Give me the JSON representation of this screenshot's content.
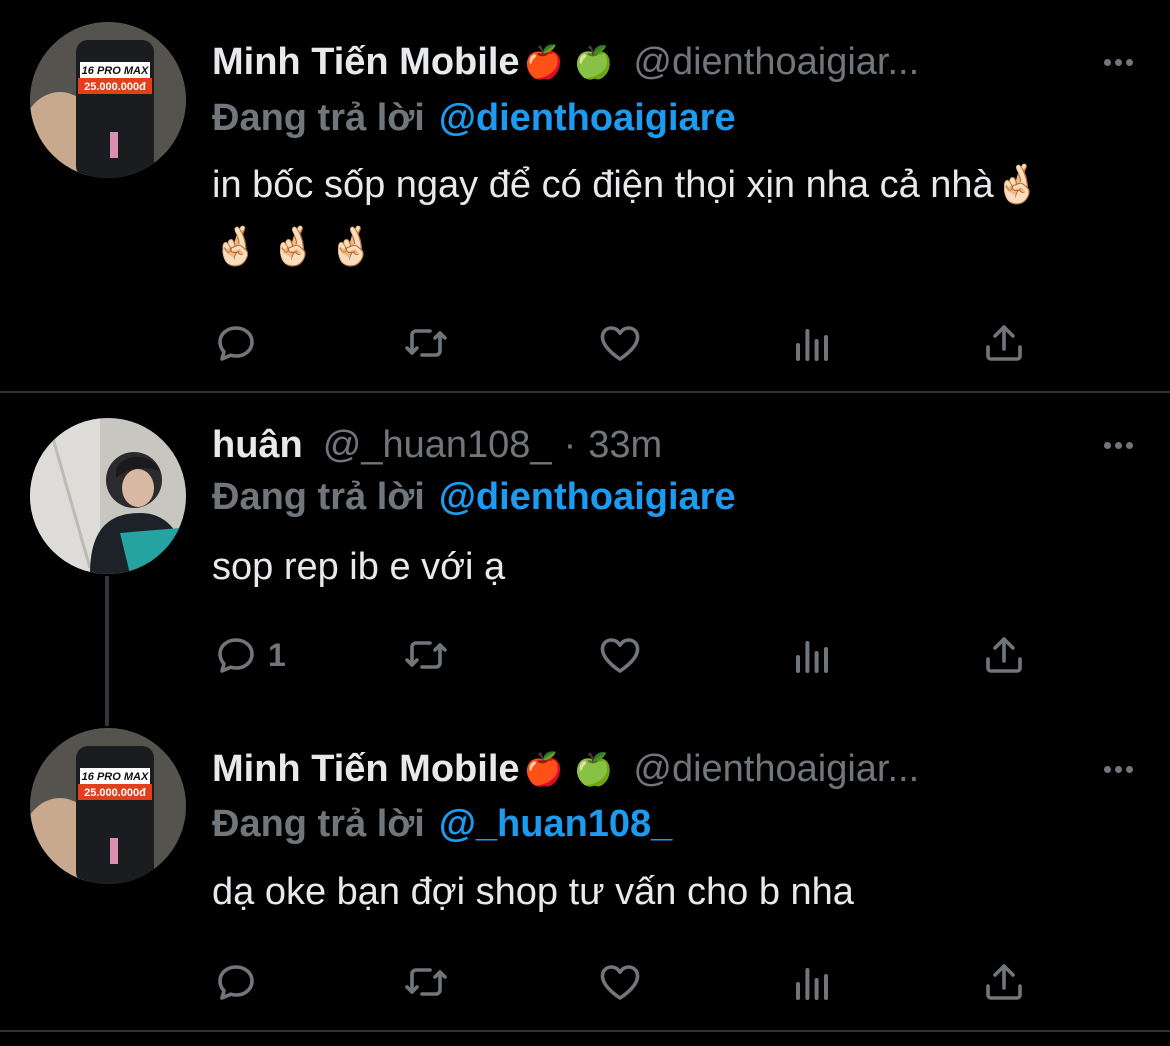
{
  "tweets": [
    {
      "name": "Minh Tiến Mobile",
      "badges": "🍎 🍏",
      "handle": "@dienthoaigiar...",
      "time": "",
      "reply_label": "Đang trả lời",
      "reply_to": "@dienthoaigiare",
      "text": "in bốc sốp ngay để có điện thọi xịn nha cả nhà🤞🏻 🤞🏻 🤞🏻 🤞🏻",
      "reply_count": "",
      "avatar": {
        "label1": "16 PRO MAX",
        "label2": "25.000.000đ"
      }
    },
    {
      "name": "huân",
      "badges": "",
      "handle": "@_huan108_",
      "sep": "·",
      "time": "33m",
      "reply_label": "Đang trả lời",
      "reply_to": "@dienthoaigiare",
      "text": "sop rep ib e với ạ",
      "reply_count": "1"
    },
    {
      "name": "Minh Tiến Mobile",
      "badges": "🍎 🍏",
      "handle": "@dienthoaigiar...",
      "time": "",
      "reply_label": "Đang trả lời",
      "reply_to": "@_huan108_",
      "text": "dạ oke bạn đợi shop tư vấn cho b nha",
      "reply_count": "",
      "avatar": {
        "label1": "16 PRO MAX",
        "label2": "25.000.000đ"
      }
    }
  ],
  "icons": {
    "reply": "reply-icon",
    "retweet": "retweet-icon",
    "like": "heart-icon",
    "views": "views-icon",
    "share": "share-icon",
    "more": "more-icon"
  },
  "colors": {
    "background": "#000000",
    "primary_text": "#e7e9ea",
    "secondary_text": "#71767b",
    "accent": "#1d9bf0",
    "divider": "#2f3336"
  }
}
